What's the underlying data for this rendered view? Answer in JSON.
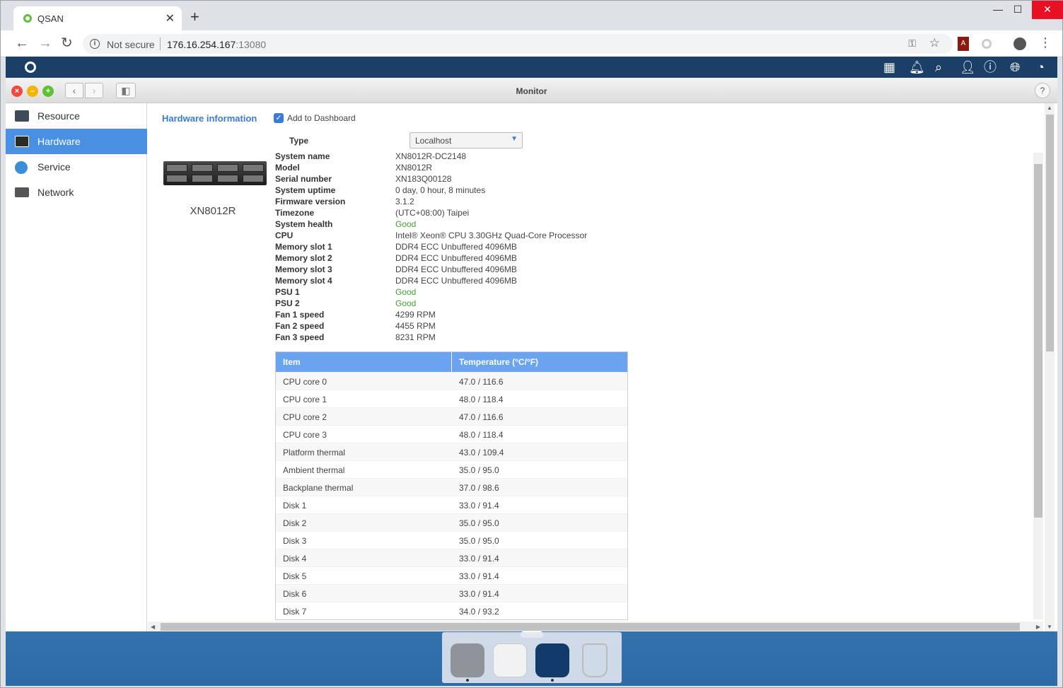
{
  "browser": {
    "tab_title": "QSAN",
    "security_label": "Not secure",
    "url_host": "176.16.254.167",
    "url_port": ":13080"
  },
  "window": {
    "title": "Monitor"
  },
  "sidebar": {
    "items": [
      {
        "label": "Resource",
        "icon": "resource-chart-icon"
      },
      {
        "label": "Hardware",
        "icon": "hardware-server-icon",
        "active": true
      },
      {
        "label": "Service",
        "icon": "service-globe-icon"
      },
      {
        "label": "Network",
        "icon": "network-switch-icon"
      }
    ]
  },
  "hardware": {
    "section_title": "Hardware information",
    "add_to_dashboard_label": "Add to Dashboard",
    "add_to_dashboard_checked": true,
    "type_label": "Type",
    "type_value": "Localhost",
    "model_caption": "XN8012R",
    "specs": [
      {
        "key": "System name",
        "value": "XN8012R-DC2148"
      },
      {
        "key": "Model",
        "value": "XN8012R"
      },
      {
        "key": "Serial number",
        "value": "XN183Q00128"
      },
      {
        "key": "System uptime",
        "value": "0 day, 0 hour, 8 minutes"
      },
      {
        "key": "Firmware version",
        "value": "3.1.2"
      },
      {
        "key": "Timezone",
        "value": "(UTC+08:00) Taipei"
      },
      {
        "key": "System health",
        "value": "Good",
        "status": "good"
      },
      {
        "key": "CPU",
        "value": "Intel® Xeon® CPU 3.30GHz Quad-Core Processor"
      },
      {
        "key": "Memory slot 1",
        "value": "DDR4 ECC Unbuffered 4096MB"
      },
      {
        "key": "Memory slot 2",
        "value": "DDR4 ECC Unbuffered 4096MB"
      },
      {
        "key": "Memory slot 3",
        "value": "DDR4 ECC Unbuffered 4096MB"
      },
      {
        "key": "Memory slot 4",
        "value": "DDR4 ECC Unbuffered 4096MB"
      },
      {
        "key": "PSU 1",
        "value": "Good",
        "status": "good"
      },
      {
        "key": "PSU 2",
        "value": "Good",
        "status": "good"
      },
      {
        "key": "Fan 1 speed",
        "value": "4299 RPM"
      },
      {
        "key": "Fan 2 speed",
        "value": "4455 RPM"
      },
      {
        "key": "Fan 3 speed",
        "value": "8231 RPM"
      }
    ],
    "temperature_table": {
      "headers": [
        "Item",
        "Temperature (°C/°F)"
      ],
      "rows": [
        [
          "CPU core 0",
          "47.0 / 116.6"
        ],
        [
          "CPU core 1",
          "48.0 / 118.4"
        ],
        [
          "CPU core 2",
          "47.0 / 116.6"
        ],
        [
          "CPU core 3",
          "48.0 / 118.4"
        ],
        [
          "Platform thermal",
          "43.0 / 109.4"
        ],
        [
          "Ambient thermal",
          "35.0 / 95.0"
        ],
        [
          "Backplane thermal",
          "37.0 / 98.6"
        ],
        [
          "Disk 1",
          "33.0 / 91.4"
        ],
        [
          "Disk 2",
          "35.0 / 95.0"
        ],
        [
          "Disk 3",
          "35.0 / 95.0"
        ],
        [
          "Disk 4",
          "33.0 / 91.4"
        ],
        [
          "Disk 5",
          "33.0 / 91.4"
        ],
        [
          "Disk 6",
          "33.0 / 91.4"
        ],
        [
          "Disk 7",
          "34.0 / 93.2"
        ]
      ]
    }
  },
  "colors": {
    "accent": "#4a90e2",
    "title_blue": "#3a7bd5",
    "good_green": "#3aa52e",
    "topbar": "#1b3f66",
    "table_header": "#6aa4f0"
  },
  "dock": {
    "apps": [
      "control-panel-icon",
      "app-center-icon",
      "monitor-icon",
      "recycle-bin-icon"
    ]
  }
}
